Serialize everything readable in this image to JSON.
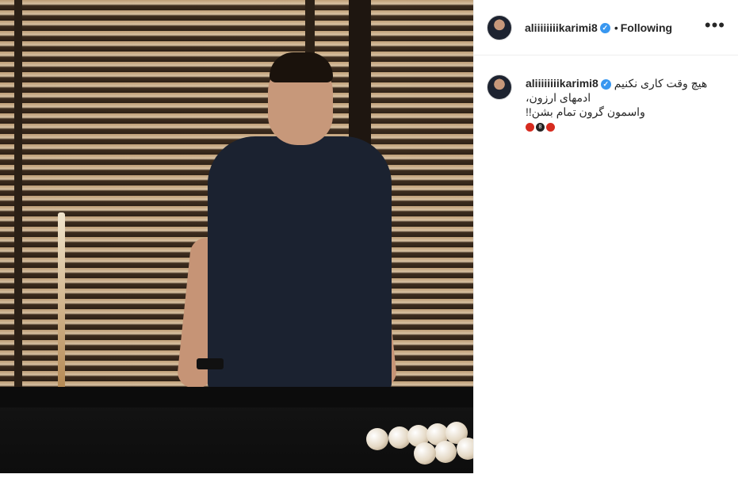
{
  "post": {
    "username": "aliiiiiiiikarimi8",
    "verified_icon": "verified-badge-icon",
    "separator": "•",
    "follow_status": "Following",
    "more_icon": "more-options-icon",
    "more_glyph": "•••"
  },
  "caption": {
    "username": "aliiiiiiiikarimi8",
    "lines": [
      "هیچ وقت کاری نکنیم",
      "،ادمهای ارزون",
      "!!واسمون گرون تمام بشن"
    ],
    "emoji": [
      "apple-emoji",
      "8-ball-emoji",
      "apple-emoji"
    ],
    "eight_ball_label": "8"
  },
  "colors": {
    "verified": "#3897f0",
    "text": "#262626",
    "border": "#efefef"
  }
}
